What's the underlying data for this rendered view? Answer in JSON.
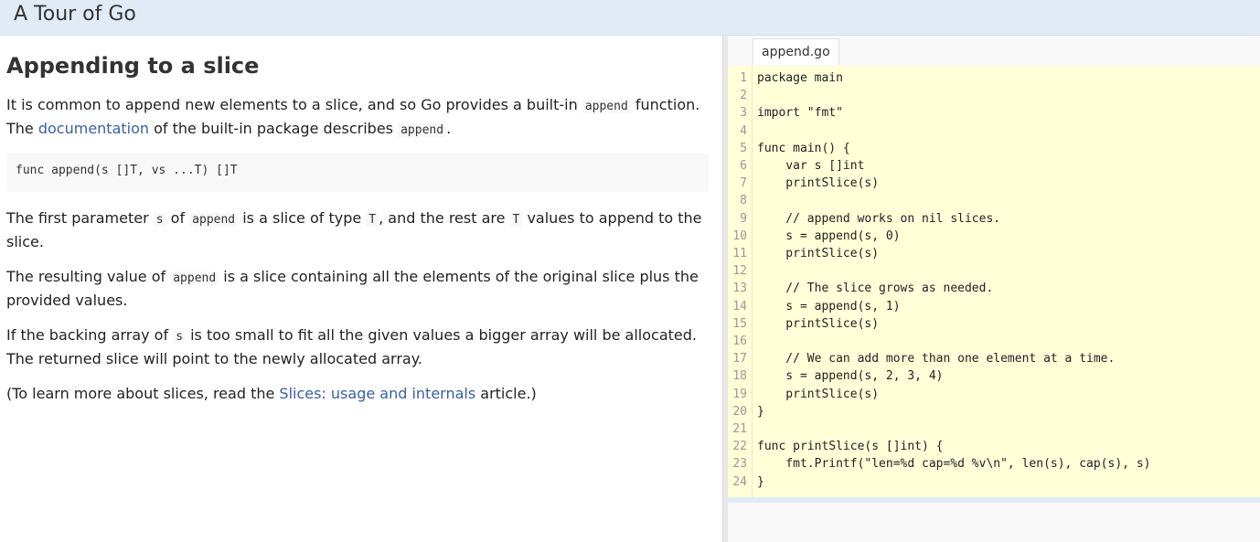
{
  "app": {
    "title": "A Tour of Go"
  },
  "lesson": {
    "title": "Appending to a slice",
    "p1": {
      "t1": "It is common to append new elements to a slice, and so Go provides a built-in ",
      "c1": "append",
      "t2": " function.",
      "t3": "The ",
      "link": "documentation",
      "t4": " of the built-in package describes ",
      "c2": "append",
      "t5": "."
    },
    "signature": "func append(s []T, vs ...T) []T",
    "p2": {
      "t1": "The first parameter ",
      "c1": "s",
      "t2": " of ",
      "c2": "append",
      "t3": " is a slice of type ",
      "c3": "T",
      "t4": ", and the rest are ",
      "c4": "T",
      "t5": " values to append to the",
      "t6": "slice."
    },
    "p3": {
      "t1": "The resulting value of ",
      "c1": "append",
      "t2": " is a slice containing all the elements of the original slice plus the",
      "t3": "provided values."
    },
    "p4": {
      "t1": "If the backing array of ",
      "c1": "s",
      "t2": " is too small to fit all the given values a bigger array will be allocated.",
      "t3": "The returned slice will point to the newly allocated array."
    },
    "p5": {
      "t1": "(To learn more about slices, read the ",
      "link": "Slices: usage and internals",
      "t2": " article.)"
    }
  },
  "editor": {
    "filename": "append.go",
    "lines": [
      "package main",
      "",
      "import \"fmt\"",
      "",
      "func main() {",
      "    var s []int",
      "    printSlice(s)",
      "",
      "    // append works on nil slices.",
      "    s = append(s, 0)",
      "    printSlice(s)",
      "",
      "    // The slice grows as needed.",
      "    s = append(s, 1)",
      "    printSlice(s)",
      "",
      "    // We can add more than one element at a time.",
      "    s = append(s, 2, 3, 4)",
      "    printSlice(s)",
      "}",
      "",
      "func printSlice(s []int) {",
      "    fmt.Printf(\"len=%d cap=%d %v\\n\", len(s), cap(s), s)",
      "}"
    ],
    "line_numbers": [
      "1",
      "2",
      "3",
      "4",
      "5",
      "6",
      "7",
      "8",
      "9",
      "10",
      "11",
      "12",
      "13",
      "14",
      "15",
      "16",
      "17",
      "18",
      "19",
      "20",
      "21",
      "22",
      "23",
      "24"
    ]
  }
}
